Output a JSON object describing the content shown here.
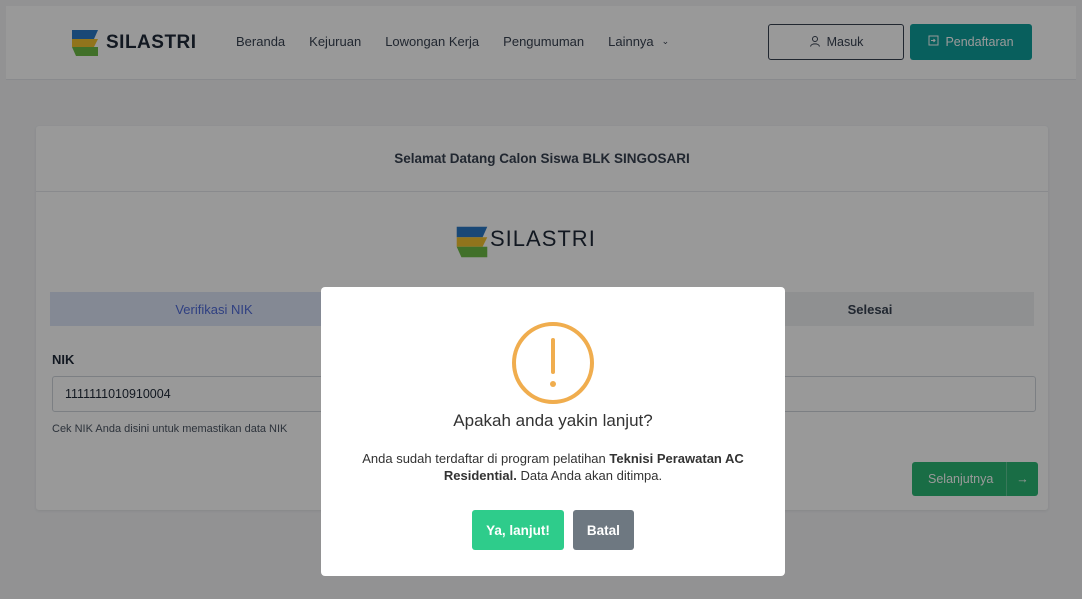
{
  "header": {
    "brand": "SILASTRI",
    "nav": [
      {
        "label": "Beranda"
      },
      {
        "label": "Kejuruan"
      },
      {
        "label": "Lowongan Kerja"
      },
      {
        "label": "Pengumuman"
      },
      {
        "label": "Lainnya"
      }
    ],
    "login_label": "Masuk",
    "register_label": "Pendaftaran"
  },
  "card": {
    "title": "Selamat Datang Calon Siswa BLK SINGOSARI",
    "brand": "SILASTRI",
    "steps": [
      {
        "label": "Verifikasi NIK"
      },
      {
        "label": "Selesai"
      }
    ],
    "nik_label": "NIK",
    "nik_value": "1111111010910004",
    "nik_help": "Cek NIK Anda disini untuk memastikan data NIK",
    "next_label": "Selanjutnya"
  },
  "modal": {
    "title": "Apakah anda yakin lanjut?",
    "text_prefix": "Anda sudah terdaftar di program pelatihan ",
    "program": "Teknisi Perawatan AC Residential.",
    "text_suffix": " Data Anda akan ditimpa.",
    "confirm_label": "Ya, lanjut!",
    "cancel_label": "Batal"
  },
  "colors": {
    "primary_teal": "#0e9f9b",
    "success_green": "#2bb673",
    "warning_orange": "#f0ad4e",
    "active_step_bg": "#dde4f7",
    "active_step_text": "#4f6bd8",
    "cancel_gray": "#6e7881",
    "logo_blue": "#2b78c5",
    "logo_yellow": "#f2c230",
    "logo_green": "#6dbb45"
  },
  "icons": {
    "user": "user-icon",
    "login": "login-icon",
    "arrow": "arrow-right-icon",
    "warning": "warning-icon"
  }
}
